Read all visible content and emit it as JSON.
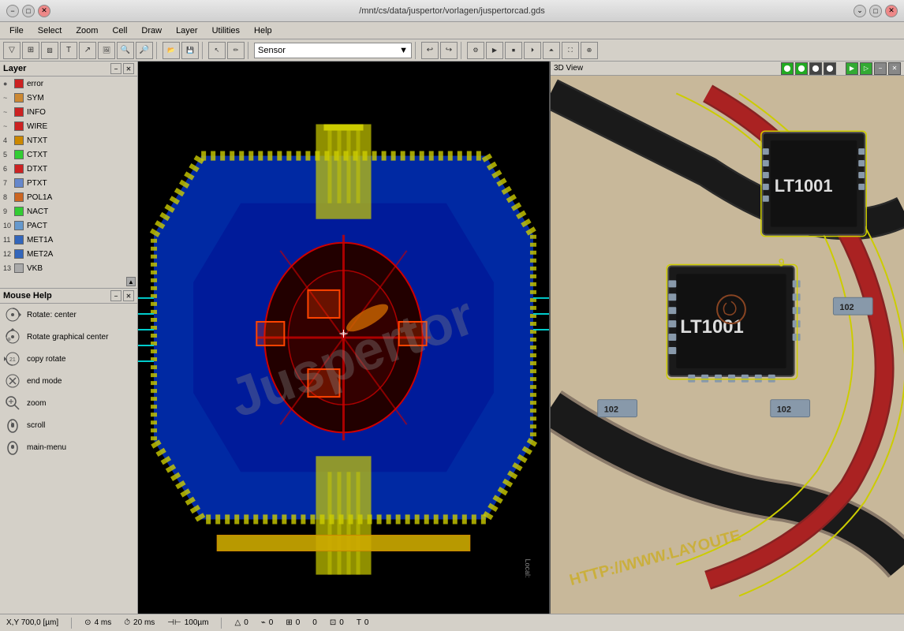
{
  "titlebar": {
    "title": "/mnt/cs/data/juspertor/vorlagen/juspertorcad.gds",
    "min_btn": "−",
    "max_btn": "□",
    "close_btn": "✕"
  },
  "menubar": {
    "items": [
      "File",
      "Select",
      "Zoom",
      "Cell",
      "Draw",
      "Layer",
      "Utilities",
      "Help"
    ]
  },
  "toolbar": {
    "sensor_label": "Sensor",
    "buttons": [
      "▽",
      "⊞",
      "⊟",
      "T",
      "↗",
      "🔍",
      "🔎",
      "⬛",
      "💾",
      "✏",
      "↩",
      "↪",
      "⚙",
      "▶",
      "📋",
      "◀"
    ]
  },
  "layers": [
    {
      "num": "",
      "name": "error",
      "color": "#cc2222",
      "eye": "●"
    },
    {
      "num": "~",
      "name": "SYM",
      "color": "#cc8833",
      "eye": "●"
    },
    {
      "num": "~",
      "name": "INFO",
      "color": "#cc2222",
      "eye": "●"
    },
    {
      "num": "~",
      "name": "WIRE",
      "color": "#cc2222",
      "eye": "●"
    },
    {
      "num": "4",
      "name": "NTXT",
      "color": "#cc8800",
      "eye": "●"
    },
    {
      "num": "5",
      "name": "CTXT",
      "color": "#33cc33",
      "eye": "●"
    },
    {
      "num": "6",
      "name": "DTXT",
      "color": "#cc2222",
      "eye": "●"
    },
    {
      "num": "7",
      "name": "PTXT",
      "color": "#6688cc",
      "eye": "●"
    },
    {
      "num": "8",
      "name": "POL1A",
      "color": "#cc6622",
      "eye": "●"
    },
    {
      "num": "9",
      "name": "NACT",
      "color": "#33cc33",
      "eye": "●"
    },
    {
      "num": "10",
      "name": "PACT",
      "color": "#6699cc",
      "eye": "●"
    },
    {
      "num": "11",
      "name": "MET1A",
      "color": "#3366bb",
      "eye": "●"
    },
    {
      "num": "12",
      "name": "MET2A",
      "color": "#3366bb",
      "eye": "●"
    },
    {
      "num": "13",
      "name": "VKB",
      "color": "#aaaaaa",
      "eye": "●"
    }
  ],
  "mouse_help": {
    "title": "Mouse Help",
    "items": [
      {
        "icon": "rotate",
        "label": "Rotate: center"
      },
      {
        "icon": "rotate-graphic",
        "label": "Rotate graphical center"
      },
      {
        "icon": "copy-rotate",
        "label": "copy rotate"
      },
      {
        "icon": "end-mode",
        "label": "end mode"
      },
      {
        "icon": "zoom",
        "label": "zoom"
      },
      {
        "icon": "scroll",
        "label": "scroll"
      },
      {
        "icon": "main-menu",
        "label": "main-menu"
      }
    ]
  },
  "statusbar": {
    "coords": "X,Y 700,0 [µm]",
    "time1": "4 ms",
    "time2": "20 ms",
    "scale": "100µm",
    "val1": "0",
    "val2": "0",
    "val3": "0",
    "val4": "0",
    "val5": "0",
    "val6": "0"
  },
  "view3d": {
    "title": "3D View"
  },
  "pcb": {
    "watermark": "Juspertor"
  },
  "colors": {
    "bg_dark": "#000000",
    "bg_blue": "#0000cc",
    "bg_pcb": "#1a1a2e",
    "accent_blue": "#3355ff",
    "accent_red": "#cc2222",
    "accent_yellow": "#cccc00",
    "view3d_bg": "#c8b89a"
  }
}
